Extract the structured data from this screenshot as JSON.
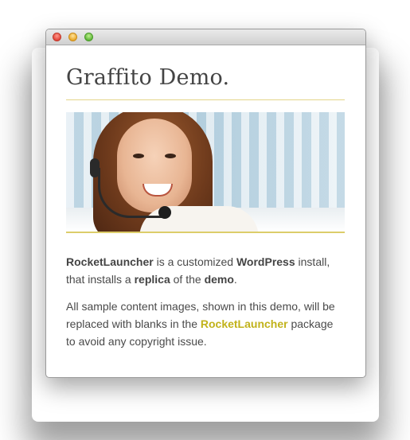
{
  "window": {
    "controls": [
      "close-icon",
      "minimize-icon",
      "maximize-icon"
    ]
  },
  "page": {
    "title": "Graffito Demo.",
    "accent_color": "#dccd6a",
    "link_color": "#c1b21a",
    "hero_alt": "Smiling woman wearing a headset",
    "paragraph1": {
      "strong_product": "RocketLauncher",
      "text1": " is a customized ",
      "strong_platform": "WordPress",
      "text2": " install, that installs a ",
      "strong_replica": "replica",
      "text3": " of the ",
      "strong_demo": "demo",
      "text4": "."
    },
    "paragraph2": {
      "text1": "All sample content images, shown in this demo, will be replaced with blanks in the ",
      "link": "RocketLauncher",
      "text2": " package to avoid any copyright issue."
    }
  }
}
